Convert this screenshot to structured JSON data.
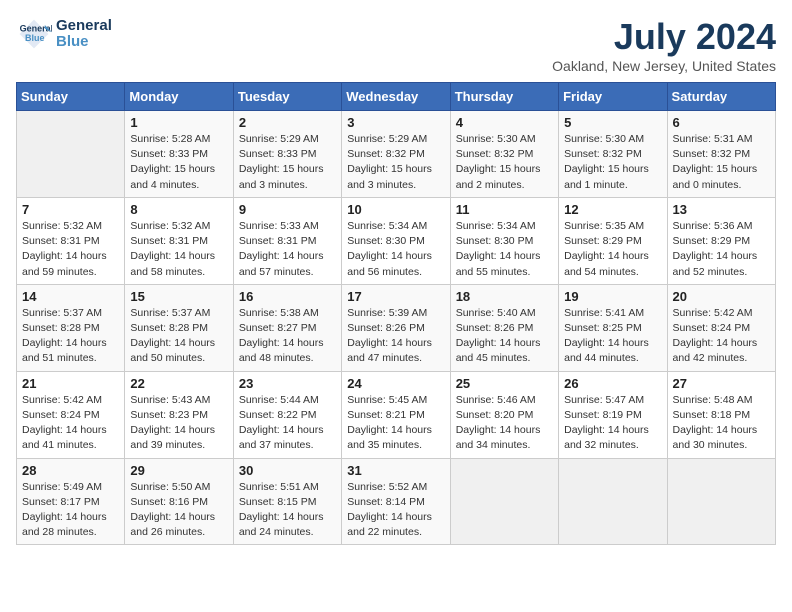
{
  "logo": {
    "line1": "General",
    "line2": "Blue"
  },
  "title": "July 2024",
  "subtitle": "Oakland, New Jersey, United States",
  "headers": [
    "Sunday",
    "Monday",
    "Tuesday",
    "Wednesday",
    "Thursday",
    "Friday",
    "Saturday"
  ],
  "weeks": [
    [
      {
        "day": "",
        "info": ""
      },
      {
        "day": "1",
        "info": "Sunrise: 5:28 AM\nSunset: 8:33 PM\nDaylight: 15 hours\nand 4 minutes."
      },
      {
        "day": "2",
        "info": "Sunrise: 5:29 AM\nSunset: 8:33 PM\nDaylight: 15 hours\nand 3 minutes."
      },
      {
        "day": "3",
        "info": "Sunrise: 5:29 AM\nSunset: 8:32 PM\nDaylight: 15 hours\nand 3 minutes."
      },
      {
        "day": "4",
        "info": "Sunrise: 5:30 AM\nSunset: 8:32 PM\nDaylight: 15 hours\nand 2 minutes."
      },
      {
        "day": "5",
        "info": "Sunrise: 5:30 AM\nSunset: 8:32 PM\nDaylight: 15 hours\nand 1 minute."
      },
      {
        "day": "6",
        "info": "Sunrise: 5:31 AM\nSunset: 8:32 PM\nDaylight: 15 hours\nand 0 minutes."
      }
    ],
    [
      {
        "day": "7",
        "info": "Sunrise: 5:32 AM\nSunset: 8:31 PM\nDaylight: 14 hours\nand 59 minutes."
      },
      {
        "day": "8",
        "info": "Sunrise: 5:32 AM\nSunset: 8:31 PM\nDaylight: 14 hours\nand 58 minutes."
      },
      {
        "day": "9",
        "info": "Sunrise: 5:33 AM\nSunset: 8:31 PM\nDaylight: 14 hours\nand 57 minutes."
      },
      {
        "day": "10",
        "info": "Sunrise: 5:34 AM\nSunset: 8:30 PM\nDaylight: 14 hours\nand 56 minutes."
      },
      {
        "day": "11",
        "info": "Sunrise: 5:34 AM\nSunset: 8:30 PM\nDaylight: 14 hours\nand 55 minutes."
      },
      {
        "day": "12",
        "info": "Sunrise: 5:35 AM\nSunset: 8:29 PM\nDaylight: 14 hours\nand 54 minutes."
      },
      {
        "day": "13",
        "info": "Sunrise: 5:36 AM\nSunset: 8:29 PM\nDaylight: 14 hours\nand 52 minutes."
      }
    ],
    [
      {
        "day": "14",
        "info": "Sunrise: 5:37 AM\nSunset: 8:28 PM\nDaylight: 14 hours\nand 51 minutes."
      },
      {
        "day": "15",
        "info": "Sunrise: 5:37 AM\nSunset: 8:28 PM\nDaylight: 14 hours\nand 50 minutes."
      },
      {
        "day": "16",
        "info": "Sunrise: 5:38 AM\nSunset: 8:27 PM\nDaylight: 14 hours\nand 48 minutes."
      },
      {
        "day": "17",
        "info": "Sunrise: 5:39 AM\nSunset: 8:26 PM\nDaylight: 14 hours\nand 47 minutes."
      },
      {
        "day": "18",
        "info": "Sunrise: 5:40 AM\nSunset: 8:26 PM\nDaylight: 14 hours\nand 45 minutes."
      },
      {
        "day": "19",
        "info": "Sunrise: 5:41 AM\nSunset: 8:25 PM\nDaylight: 14 hours\nand 44 minutes."
      },
      {
        "day": "20",
        "info": "Sunrise: 5:42 AM\nSunset: 8:24 PM\nDaylight: 14 hours\nand 42 minutes."
      }
    ],
    [
      {
        "day": "21",
        "info": "Sunrise: 5:42 AM\nSunset: 8:24 PM\nDaylight: 14 hours\nand 41 minutes."
      },
      {
        "day": "22",
        "info": "Sunrise: 5:43 AM\nSunset: 8:23 PM\nDaylight: 14 hours\nand 39 minutes."
      },
      {
        "day": "23",
        "info": "Sunrise: 5:44 AM\nSunset: 8:22 PM\nDaylight: 14 hours\nand 37 minutes."
      },
      {
        "day": "24",
        "info": "Sunrise: 5:45 AM\nSunset: 8:21 PM\nDaylight: 14 hours\nand 35 minutes."
      },
      {
        "day": "25",
        "info": "Sunrise: 5:46 AM\nSunset: 8:20 PM\nDaylight: 14 hours\nand 34 minutes."
      },
      {
        "day": "26",
        "info": "Sunrise: 5:47 AM\nSunset: 8:19 PM\nDaylight: 14 hours\nand 32 minutes."
      },
      {
        "day": "27",
        "info": "Sunrise: 5:48 AM\nSunset: 8:18 PM\nDaylight: 14 hours\nand 30 minutes."
      }
    ],
    [
      {
        "day": "28",
        "info": "Sunrise: 5:49 AM\nSunset: 8:17 PM\nDaylight: 14 hours\nand 28 minutes."
      },
      {
        "day": "29",
        "info": "Sunrise: 5:50 AM\nSunset: 8:16 PM\nDaylight: 14 hours\nand 26 minutes."
      },
      {
        "day": "30",
        "info": "Sunrise: 5:51 AM\nSunset: 8:15 PM\nDaylight: 14 hours\nand 24 minutes."
      },
      {
        "day": "31",
        "info": "Sunrise: 5:52 AM\nSunset: 8:14 PM\nDaylight: 14 hours\nand 22 minutes."
      },
      {
        "day": "",
        "info": ""
      },
      {
        "day": "",
        "info": ""
      },
      {
        "day": "",
        "info": ""
      }
    ]
  ]
}
